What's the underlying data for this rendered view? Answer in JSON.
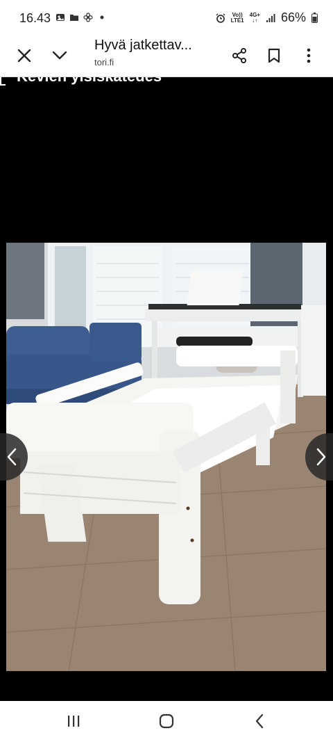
{
  "status_bar": {
    "time": "16.43",
    "network_top": "Vo))",
    "network_bottom": "LTE1",
    "data_top": "4G+",
    "battery": "66%"
  },
  "app_bar": {
    "title": "Hyvä jatkettav...",
    "subtitle": "tori.fi"
  },
  "viewer": {
    "overlay_text": "Kevien ylsiskatedes"
  },
  "icons": [
    "close-icon",
    "chevron-down-icon",
    "share-icon",
    "bookmark-icon",
    "more-vert-icon",
    "chevron-left-icon",
    "chevron-right-icon",
    "recents-icon",
    "home-icon",
    "back-icon"
  ]
}
